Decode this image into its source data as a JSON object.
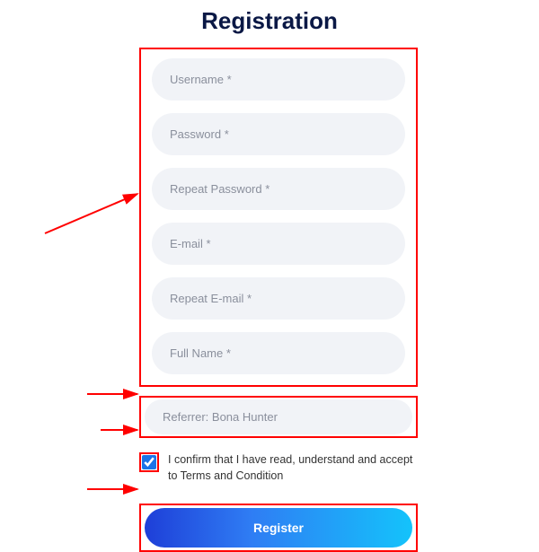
{
  "title": "Registration",
  "fields": {
    "username": "Username *",
    "password": "Password *",
    "repeat_password": "Repeat Password *",
    "email": "E-mail *",
    "repeat_email": "Repeat E-mail *",
    "full_name": "Full Name *"
  },
  "referrer": {
    "value": "Referrer: Bona Hunter"
  },
  "terms": {
    "checked": true,
    "label": "I confirm that I have read, understand and accept to Terms and Condition"
  },
  "button": {
    "register_label": "Register"
  }
}
